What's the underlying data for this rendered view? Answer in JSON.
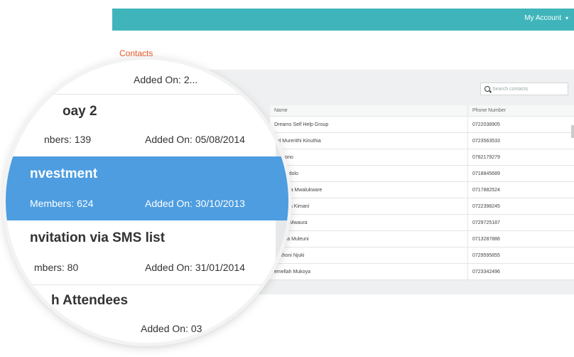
{
  "header": {
    "account_label": "My Account",
    "caret": "▾"
  },
  "page": {
    "title": "Contacts"
  },
  "search": {
    "placeholder": "Search contacts"
  },
  "table": {
    "columns": {
      "name": "Name",
      "phone": "Phone Number"
    },
    "rows": [
      {
        "name": "Dreams Self Help Group",
        "phone": "0722038905"
      },
      {
        "name": "uel Murerithi Kinuthia",
        "phone": "0723563533"
      },
      {
        "name": "Cherono",
        "phone": "0782179279"
      },
      {
        "name": "dma Ndolo",
        "phone": "0718845689"
      },
      {
        "name": "Wanyika Mwalukware",
        "phone": "0717882524"
      },
      {
        "name": "Ngang'a Kimani",
        "phone": "0722398245"
      },
      {
        "name": "mbura Mwaura",
        "phone": "0729725187"
      },
      {
        "name": "Ndinda Muleuni",
        "phone": "0713287886"
      },
      {
        "name": "Muthoni Njuki",
        "phone": "0729595855"
      },
      {
        "name": "emellah Mukoya",
        "phone": "0723342496"
      }
    ]
  },
  "magnifier": {
    "groups": [
      {
        "name": "",
        "members": "",
        "added": "Added On: 2..."
      },
      {
        "name": "oay 2",
        "members": "nbers: 139",
        "added": "Added On: 05/08/2014"
      },
      {
        "name": "nvestment",
        "members": "Members: 624",
        "added": "Added On: 30/10/2013"
      },
      {
        "name": "nvitation via SMS list",
        "members": "mbers: 80",
        "added": "Added On: 31/01/2014"
      },
      {
        "name": "h Attendees",
        "members": "",
        "added": "Added On: 03..."
      }
    ]
  },
  "colors": {
    "topbar": "#3fb5bb",
    "title": "#e85a2a",
    "selected": "#4d9de0"
  }
}
